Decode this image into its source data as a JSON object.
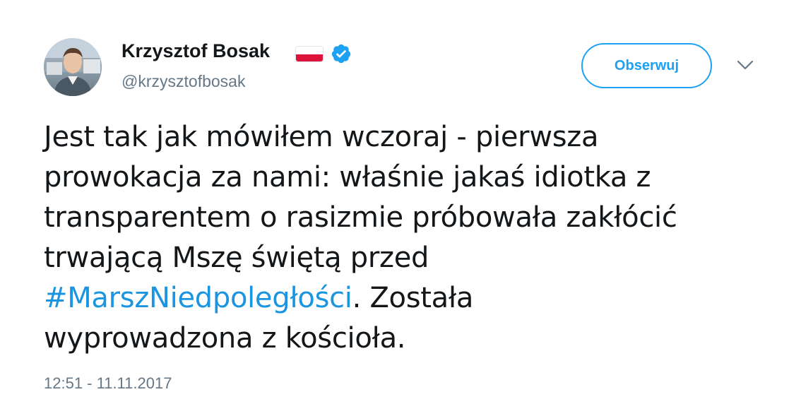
{
  "user": {
    "display_name": "Krzysztof Bosak",
    "handle": "@krzysztofbosak",
    "flag_icon": "poland-flag-icon",
    "verified_icon": "verified-badge-icon",
    "verified_color": "#1da1f2"
  },
  "actions": {
    "follow_label": "Obserwuj",
    "menu_icon": "chevron-down-icon"
  },
  "tweet": {
    "lines": [
      "Jest tak jak mówiłem wczoraj - pierwsza",
      "prowokacja za nami: właśnie jakaś idiotka z",
      "transparentem o rasizmie próbowała zakłócić",
      "trwającą Mszę świętą przed"
    ],
    "hashtag": "#MarszNiedpoległości",
    "after_hashtag": ". Została",
    "last_line": "wyprowadzona z kościoła.",
    "timestamp": "12:51 - 11.11.2017"
  },
  "colors": {
    "accent": "#1da1f2",
    "hashtag": "#1b95e0",
    "text": "#14171a",
    "secondary_text": "#657786"
  }
}
